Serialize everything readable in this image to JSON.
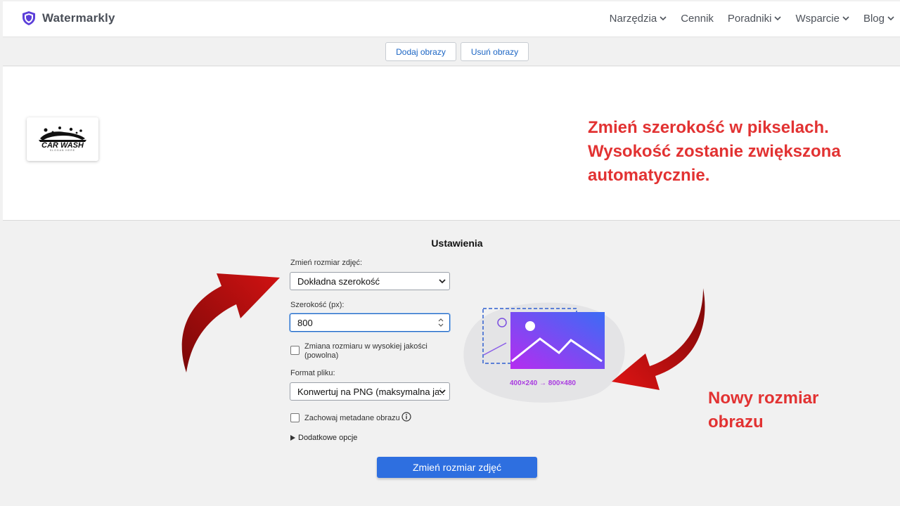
{
  "header": {
    "brand": "Watermarkly",
    "nav": [
      {
        "label": "Narzędzia",
        "has_menu": true
      },
      {
        "label": "Cennik",
        "has_menu": false
      },
      {
        "label": "Poradniki",
        "has_menu": true
      },
      {
        "label": "Wsparcie",
        "has_menu": true
      },
      {
        "label": "Blog",
        "has_menu": true
      }
    ]
  },
  "toolbar": {
    "add_label": "Dodaj obrazy",
    "remove_label": "Usuń obrazy"
  },
  "thumbnail": {
    "logo_text": "CAR WASH",
    "logo_subtext": "SLOGAN HERE"
  },
  "annotations": {
    "top_lines": [
      "Zmień szerokość w pikselach.",
      "Wysokość zostanie zwiększona",
      "automatycznie."
    ],
    "bottom_lines": [
      "Nowy rozmiar",
      "obrazu"
    ],
    "color": "#e23232"
  },
  "settings": {
    "title": "Ustawienia",
    "resize_label": "Zmień rozmiar zdjęć:",
    "resize_value": "Dokładna szerokość",
    "width_label": "Szerokość (px):",
    "width_value": "800",
    "hq_label_line1": "Zmiana rozmiaru w wysokiej jakości",
    "hq_label_line2": "(powolna)",
    "format_label": "Format pliku:",
    "format_value": "Konwertuj na PNG (maksymalna jak",
    "metadata_label": "Zachowaj metadane obrazu",
    "more_options": "Dodatkowe opcje",
    "submit_label": "Zmień rozmiar zdjęć",
    "size_caption": "400×240 → 800×480"
  },
  "colors": {
    "primary": "#2e6fe0",
    "link": "#1b65c4",
    "gradient_start": "#b62cf0",
    "gradient_end": "#3b6cf5"
  }
}
